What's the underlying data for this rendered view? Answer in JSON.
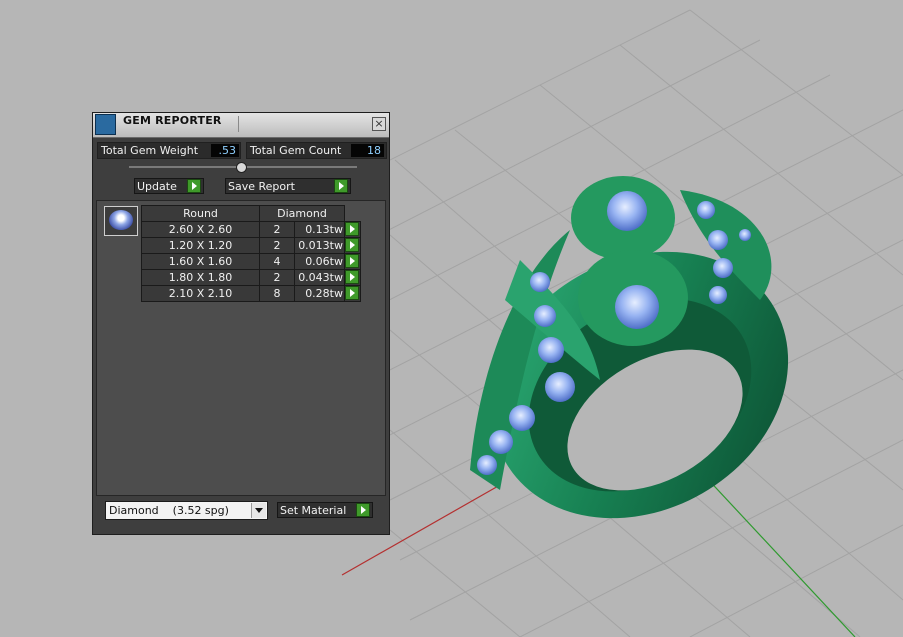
{
  "panel": {
    "title": "GEM REPORTER",
    "close_symbol": "×",
    "icon": "gem-reporter-app-icon",
    "total_gem_weight_label": "Total Gem Weight",
    "total_gem_weight_value": ".53",
    "total_gem_count_label": "Total Gem Count",
    "total_gem_count_value": "18",
    "update_label": "Update",
    "save_report_label": "Save Report"
  },
  "table": {
    "headers": [
      "Round",
      "Diamond"
    ],
    "rows": [
      {
        "size": "2.60 X 2.60",
        "qty": "2",
        "weight": "0.13tw"
      },
      {
        "size": "1.20 X 1.20",
        "qty": "2",
        "weight": "0.013tw"
      },
      {
        "size": "1.60 X 1.60",
        "qty": "4",
        "weight": "0.06tw"
      },
      {
        "size": "1.80 X 1.80",
        "qty": "2",
        "weight": "0.043tw"
      },
      {
        "size": "2.10 X 2.10",
        "qty": "8",
        "weight": "0.28tw"
      }
    ]
  },
  "material": {
    "selected": "Diamond    (3.52 spg)",
    "set_material_label": "Set Material"
  },
  "colors": {
    "ring_green": "#1a7a4e",
    "gem_blue": "#8fb0f0",
    "viewport_bg": "#b6b6b6",
    "accent_green_button": "#3f9a2a"
  }
}
